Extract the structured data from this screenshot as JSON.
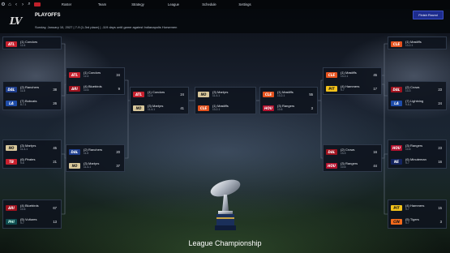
{
  "topbar": {
    "menu": [
      "Roster",
      "Team",
      "Strategy",
      "League",
      "Schedule",
      "Settings"
    ]
  },
  "header": {
    "logo": "LV",
    "title": "PLAYOFFS",
    "subtitle": "Sunday, January 10, 2027 | 7-9 (1-3rd place) | -119 days until game against Indianapolis Horsemen",
    "finish_button": "Finish Round"
  },
  "colors": {
    "ATL": "#c8202e",
    "DAL": "#1f3f8f",
    "ARI": "#a0131f",
    "NO": "#d8c79b",
    "TB": "#c8202e",
    "PHI": "#0e4c50",
    "CLE": "#e4521e",
    "PIT": "#f3c21b",
    "LA": "#1e4ca8",
    "HOU": "#b3122e",
    "NE": "#14245f",
    "CIN": "#f26a1c"
  },
  "bracket": {
    "left_r1": [
      {
        "teams": [
          {
            "abbr": "ATL",
            "name": "(1) Condors",
            "record": "12-4",
            "score": ""
          }
        ]
      },
      {
        "teams": [
          {
            "abbr": "DAL",
            "name": "(2) Ranchers",
            "record": "11-5",
            "score": "38"
          },
          {
            "abbr": "LA",
            "name": "(7) Bobcats",
            "record": "8-7-1",
            "score": "26"
          }
        ]
      },
      {
        "teams": [
          {
            "abbr": "NO",
            "name": "(3) Martyrs",
            "record": "11-4-1",
            "score": "45"
          },
          {
            "abbr": "TB",
            "name": "(6) Pirates",
            "record": "9-6",
            "score": "21"
          }
        ]
      },
      {
        "teams": [
          {
            "abbr": "ARI",
            "name": "(4) Bluebirds",
            "record": "10-6",
            "score": "67"
          },
          {
            "abbr": "PHI",
            "name": "(5) Vultures",
            "record": "9-7",
            "score": "13"
          }
        ]
      }
    ],
    "left_r2": [
      {
        "teams": [
          {
            "abbr": "ATL",
            "name": "(1) Condors",
            "record": "12-4",
            "score": "34"
          },
          {
            "abbr": "ARI",
            "name": "(4) Bluebirds",
            "record": "10-6",
            "score": "9"
          }
        ]
      },
      {
        "teams": [
          {
            "abbr": "DAL",
            "name": "(2) Ranchers",
            "record": "11-5",
            "score": "20"
          },
          {
            "abbr": "NO",
            "name": "(3) Martyrs",
            "record": "11-4-1",
            "score": "37"
          }
        ]
      }
    ],
    "left_r3": [
      {
        "teams": [
          {
            "abbr": "ATL",
            "name": "(1) Condors",
            "record": "12-4",
            "score": "24"
          },
          {
            "abbr": "NO",
            "name": "(3) Martyrs",
            "record": "11-4-1",
            "score": "41"
          }
        ]
      }
    ],
    "center": [
      {
        "teams": [
          {
            "abbr": "NO",
            "name": "(3) Martyrs",
            "record": "11-4-1",
            "score": ""
          },
          {
            "abbr": "CLE",
            "name": "(1) Mastiffs",
            "record": "13-2-1",
            "score": ""
          }
        ]
      }
    ],
    "right_r3": [
      {
        "teams": [
          {
            "abbr": "CLE",
            "name": "(1) Mastiffs",
            "record": "13-2-1",
            "score": "55"
          },
          {
            "abbr": "HOU",
            "name": "(3) Rangers",
            "record": "10-6",
            "score": "3"
          }
        ]
      }
    ],
    "right_r2": [
      {
        "teams": [
          {
            "abbr": "CLE",
            "name": "(1) Mastiffs",
            "record": "13-2-1",
            "score": "45"
          },
          {
            "abbr": "PIT",
            "name": "(4) Hammers",
            "record": "9-7",
            "score": "17"
          }
        ]
      },
      {
        "teams": [
          {
            "abbr": "DAL",
            "name": "(2) Crows",
            "record": "13-3",
            "score": "16"
          },
          {
            "abbr": "HOU",
            "name": "(3) Rangers",
            "record": "10-6",
            "score": "44"
          }
        ]
      }
    ],
    "right_r1": [
      {
        "teams": [
          {
            "abbr": "CLE",
            "name": "(1) Mastiffs",
            "record": "13-2-1",
            "score": ""
          }
        ]
      },
      {
        "teams": [
          {
            "abbr": "DAL",
            "name": "(2) Crows",
            "record": "13-3",
            "score": "23"
          },
          {
            "abbr": "LA",
            "name": "(7) Lightning",
            "record": "9-6-1",
            "score": "24"
          }
        ]
      },
      {
        "teams": [
          {
            "abbr": "HOU",
            "name": "(3) Rangers",
            "record": "10-6",
            "score": "23"
          },
          {
            "abbr": "NE",
            "name": "(6) Minuteman",
            "record": "9-7",
            "score": "16"
          }
        ]
      },
      {
        "teams": [
          {
            "abbr": "PIT",
            "name": "(4) Hammers",
            "record": "9-7",
            "score": "15"
          },
          {
            "abbr": "CIN",
            "name": "(5) Tigers",
            "record": "9-7",
            "score": "3"
          }
        ]
      }
    ]
  },
  "championship_label": "League Championship"
}
